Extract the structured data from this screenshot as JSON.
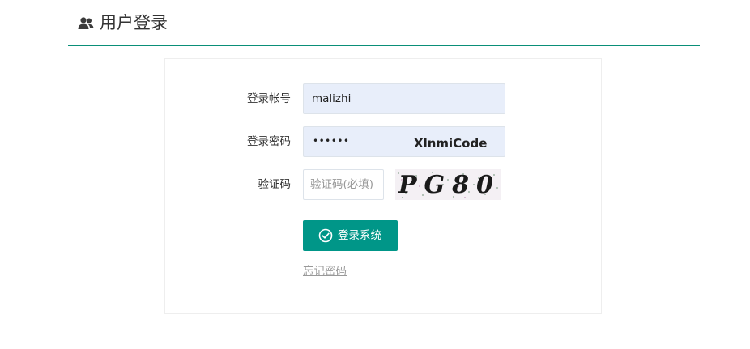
{
  "header": {
    "icon": "users-icon",
    "title": "用户登录"
  },
  "form": {
    "account_label": "登录帐号",
    "account_value": "malizhi",
    "password_label": "登录密码",
    "password_value": "••••••",
    "password_watermark": "XlnmiCode",
    "captcha_label": "验证码",
    "captcha_placeholder": "验证码(必填)",
    "captcha_image_text": "PG80"
  },
  "actions": {
    "login_button_icon": "check-circle-icon",
    "login_button_label": "登录系统",
    "forgot_password_link": "忘记密码"
  },
  "colors": {
    "accent": "#009688",
    "header_rule": "#0a8f78",
    "autofill_bg": "#e8eefa"
  }
}
